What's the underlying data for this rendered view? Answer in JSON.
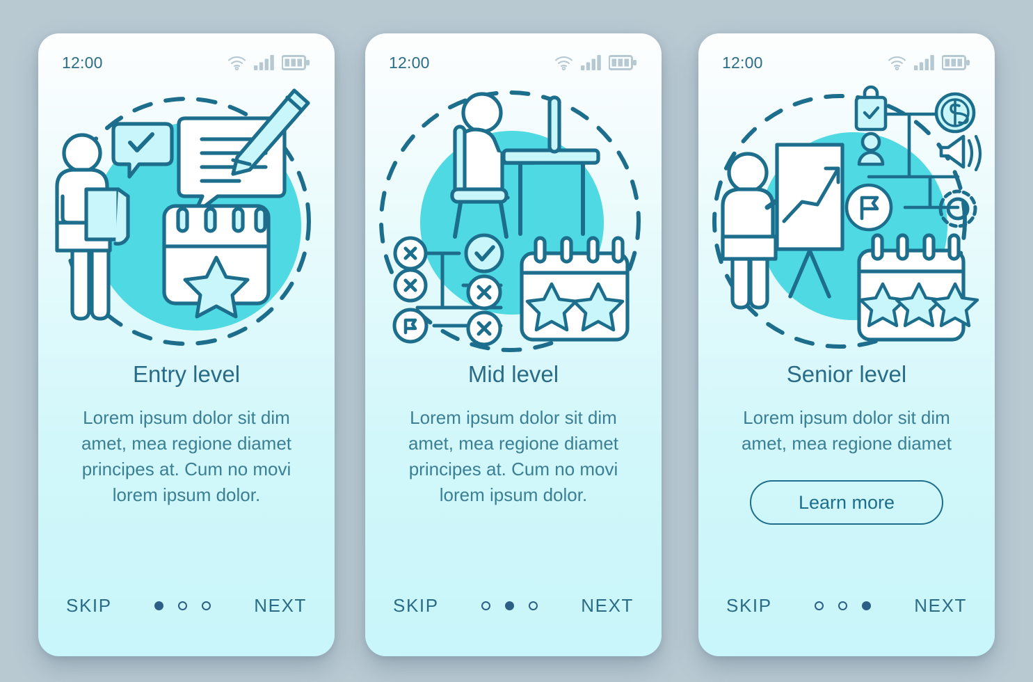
{
  "meta": {
    "background_color": "#b9c9d2",
    "stroke_color": "#1d6e8c",
    "blob_color": "#4fd9e2",
    "pale_fill": "#c9f6fb",
    "title_color": "#2a6c87",
    "body_color": "#3b7f95",
    "status_icon_color": "#b6c8d2"
  },
  "screens": [
    {
      "status": {
        "time": "12:00",
        "wifi": "wifi-icon",
        "signal": "signal-bars-icon",
        "battery": "battery-icon"
      },
      "illustration": {
        "name": "entry-level-illustration",
        "elements": [
          "dashed-circle",
          "teal-blob",
          "standing-person-with-folder",
          "checkmark-speech-bubble",
          "document-with-pencil",
          "calendar-one-star"
        ],
        "stars": 1
      },
      "title": "Entry level",
      "body": "Lorem ipsum dolor sit dim amet, mea regione diamet principes at. Cum no movi lorem ipsum dolor.",
      "cta": null,
      "footer": {
        "skip": "SKIP",
        "next": "NEXT",
        "dots": 3,
        "active_dot": 0
      }
    },
    {
      "status": {
        "time": "12:00",
        "wifi": "wifi-icon",
        "signal": "signal-bars-icon",
        "battery": "battery-icon"
      },
      "illustration": {
        "name": "mid-level-illustration",
        "elements": [
          "dashed-circle",
          "teal-blob",
          "person-at-desk-on-chair",
          "network-diagram",
          "x-circle",
          "check-circle",
          "flag-circle",
          "calendar-two-stars"
        ],
        "stars": 2
      },
      "title": "Mid level",
      "body": "Lorem ipsum dolor sit dim amet, mea regione diamet principes at. Cum no movi lorem ipsum dolor.",
      "cta": null,
      "footer": {
        "skip": "SKIP",
        "next": "NEXT",
        "dots": 3,
        "active_dot": 1
      }
    },
    {
      "status": {
        "time": "12:00",
        "wifi": "wifi-icon",
        "signal": "signal-bars-icon",
        "battery": "battery-icon"
      },
      "illustration": {
        "name": "senior-level-illustration",
        "elements": [
          "dashed-circle",
          "teal-blob",
          "presenter-person",
          "flipchart-with-growth-chart",
          "shopping-bag-check-icon",
          "user-icon",
          "dollar-coin-icon",
          "megaphone-icon",
          "flag-circle-icon",
          "gear-icon",
          "calendar-three-stars"
        ],
        "stars": 3
      },
      "title": "Senior level",
      "body": "Lorem ipsum dolor sit dim amet, mea regione diamet",
      "cta": "Learn more",
      "footer": {
        "skip": "SKIP",
        "next": "NEXT",
        "dots": 3,
        "active_dot": 2
      }
    }
  ]
}
